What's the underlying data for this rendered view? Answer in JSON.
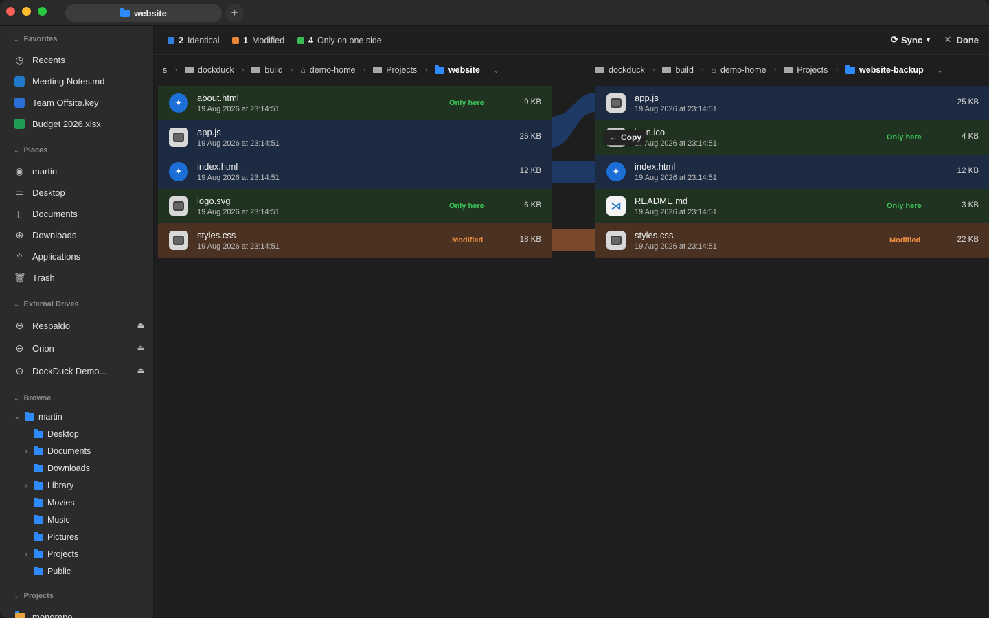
{
  "window": {
    "tab_title": "website",
    "new_tab": "+"
  },
  "sidebar": {
    "favorites_title": "Favorites",
    "favorites": [
      {
        "label": "Recents",
        "icon": "clock-icon"
      },
      {
        "label": "Meeting Notes.md",
        "icon": "vscode-icon"
      },
      {
        "label": "Team Offsite.key",
        "icon": "keynote-icon"
      },
      {
        "label": "Budget 2026.xlsx",
        "icon": "excel-icon"
      }
    ],
    "places_title": "Places",
    "places": [
      {
        "label": "martin",
        "icon": "user-icon"
      },
      {
        "label": "Desktop",
        "icon": "desktop-icon"
      },
      {
        "label": "Documents",
        "icon": "document-icon"
      },
      {
        "label": "Downloads",
        "icon": "download-icon"
      },
      {
        "label": "Applications",
        "icon": "apps-grid-icon"
      },
      {
        "label": "Trash",
        "icon": "trash-icon"
      }
    ],
    "drives_title": "External Drives",
    "drives": [
      {
        "label": "Respaldo"
      },
      {
        "label": "Orion"
      },
      {
        "label": "DockDuck Demo..."
      }
    ],
    "browse_title": "Browse",
    "browse_root": "martin",
    "browse_children": [
      {
        "label": "Desktop",
        "expandable": false
      },
      {
        "label": "Documents",
        "expandable": true
      },
      {
        "label": "Downloads",
        "expandable": false
      },
      {
        "label": "Library",
        "expandable": true
      },
      {
        "label": "Movies",
        "expandable": false
      },
      {
        "label": "Music",
        "expandable": false
      },
      {
        "label": "Pictures",
        "expandable": false
      },
      {
        "label": "Projects",
        "expandable": true
      },
      {
        "label": "Public",
        "expandable": false
      }
    ],
    "projects_title": "Projects",
    "projects_first": "monorepo"
  },
  "summary": {
    "identical_count": "2",
    "identical_label": "Identical",
    "modified_count": "1",
    "modified_label": "Modified",
    "onlyside_count": "4",
    "onlyside_label": "Only on one side",
    "sync_label": "Sync",
    "done_label": "Done",
    "colors": {
      "identical": "#2f7fe0",
      "modified": "#e8863a",
      "onlyside": "#3cba54"
    }
  },
  "left_path": [
    "​s",
    "dockduck",
    "build",
    "demo-home",
    "Projects",
    "website"
  ],
  "right_path": [
    "dockduck",
    "build",
    "demo-home",
    "Projects",
    "website-backup"
  ],
  "left_files": [
    {
      "name": "about.html",
      "date": "19 Aug 2026 at 23:14:51",
      "status": "Only here",
      "size": "9 KB",
      "kind": "only",
      "icon": "safari-icon"
    },
    {
      "name": "app.js",
      "date": "19 Aug 2026 at 23:14:51",
      "status": "",
      "size": "25 KB",
      "kind": "ident",
      "icon": "generic-file-icon"
    },
    {
      "name": "index.html",
      "date": "19 Aug 2026 at 23:14:51",
      "status": "",
      "size": "12 KB",
      "kind": "ident",
      "icon": "safari-icon"
    },
    {
      "name": "logo.svg",
      "date": "19 Aug 2026 at 23:14:51",
      "status": "Only here",
      "size": "6 KB",
      "kind": "only",
      "icon": "generic-file-icon"
    },
    {
      "name": "styles.css",
      "date": "19 Aug 2026 at 23:14:51",
      "status": "Modified",
      "size": "18 KB",
      "kind": "mod",
      "icon": "generic-file-icon"
    }
  ],
  "right_files": [
    {
      "name": "app.js",
      "date": "19 Aug 2026 at 23:14:51",
      "status": "",
      "size": "25 KB",
      "kind": "ident",
      "icon": "generic-file-icon"
    },
    {
      "name": "icon.ico",
      "date": "19 Aug 2026 at 23:14:51",
      "status": "Only here",
      "size": "4 KB",
      "kind": "only",
      "icon": "generic-file-icon"
    },
    {
      "name": "index.html",
      "date": "19 Aug 2026 at 23:14:51",
      "status": "",
      "size": "12 KB",
      "kind": "ident",
      "icon": "safari-icon"
    },
    {
      "name": "README.md",
      "date": "19 Aug 2026 at 23:14:51",
      "status": "Only here",
      "size": "3 KB",
      "kind": "only",
      "icon": "vscode-icon"
    },
    {
      "name": "styles.css",
      "date": "19 Aug 2026 at 23:14:51",
      "status": "Modified",
      "size": "22 KB",
      "kind": "mod",
      "icon": "generic-file-icon"
    }
  ],
  "copy_tooltip": "Copy"
}
